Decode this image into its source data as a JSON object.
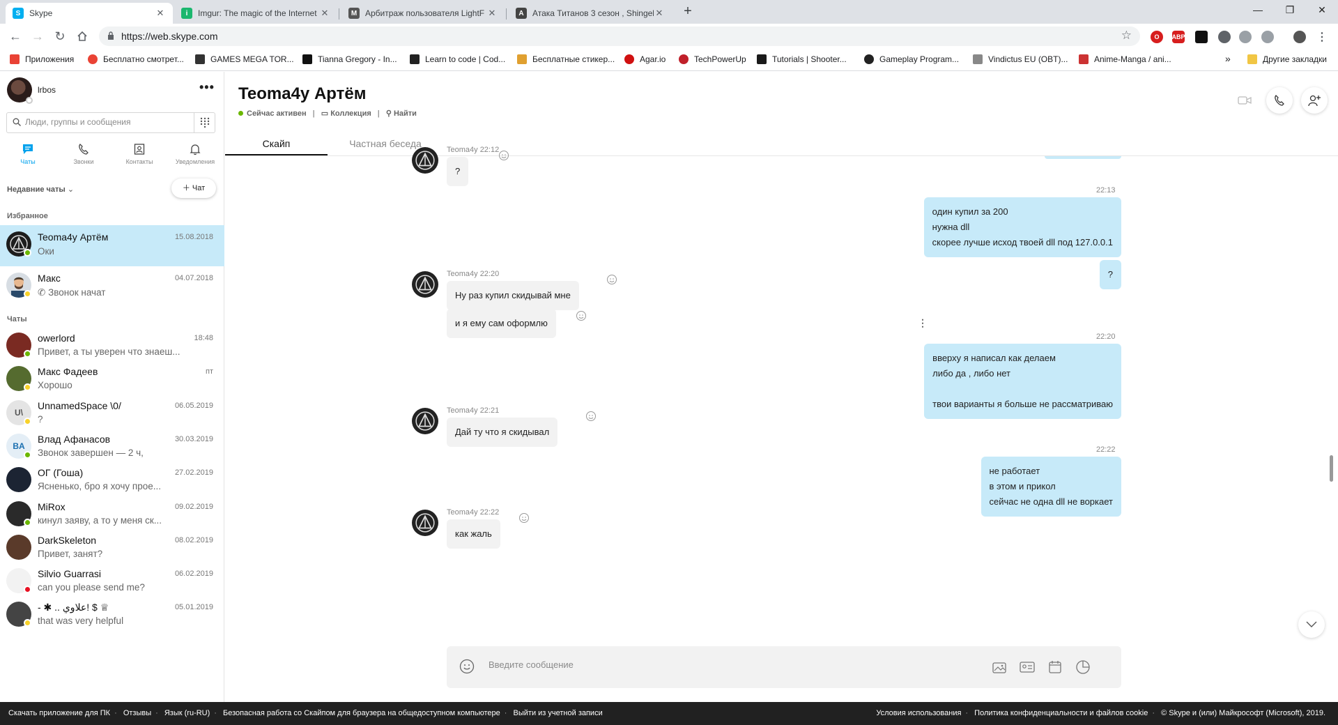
{
  "browser": {
    "tabs": [
      {
        "title": "Skype",
        "color": "#00aff0",
        "letter": "S"
      },
      {
        "title": "Imgur: The magic of the Internet",
        "color": "#1bb76e",
        "letter": "i"
      },
      {
        "title": "Арбитраж пользователя LightF",
        "color": "#555555",
        "letter": "M"
      },
      {
        "title": "Атака Титанов 3 сезон , Shingeki",
        "color": "#444444",
        "letter": "A"
      }
    ],
    "url": "https://web.skype.com",
    "bookmarks": [
      {
        "label": "Приложения",
        "color": "#e94235"
      },
      {
        "label": "Бесплатно смотрет...",
        "color": "#ea4335"
      },
      {
        "label": "GAMES MEGA TOR...",
        "color": "#333333"
      },
      {
        "label": "Tianna Gregory - In...",
        "color": "#111111"
      },
      {
        "label": "Learn to code | Cod...",
        "color": "#222222"
      },
      {
        "label": "Бесплатные стикер...",
        "color": "#e0a030"
      },
      {
        "label": "Agar.io",
        "color": "#d01010"
      },
      {
        "label": "TechPowerUp",
        "color": "#c0202a"
      },
      {
        "label": "Tutorials | Shooter...",
        "color": "#1a1a1a"
      },
      {
        "label": "Gameplay Program...",
        "color": "#222222"
      },
      {
        "label": "Vindictus EU (OBT)...",
        "color": "#888888"
      },
      {
        "label": "Anime-Manga / ani...",
        "color": "#cc3333"
      }
    ],
    "bookmarks_more": "»",
    "other_bookmarks": "Другие закладки"
  },
  "profile": {
    "name": "lrbos"
  },
  "search": {
    "placeholder": "Люди, группы и сообщения"
  },
  "nav": {
    "chats": "Чаты",
    "calls": "Звонки",
    "contacts": "Контакты",
    "notifications": "Уведомления"
  },
  "recent_label": "Недавние чаты",
  "new_chat_label": "Чат",
  "favorites_label": "Избранное",
  "chats_label": "Чаты",
  "favorites": [
    {
      "name": "Teoma4y Артём",
      "preview": "Оки",
      "date": "15.08.2018",
      "status": "#6bb700"
    },
    {
      "name": "Макс",
      "preview": "Звонок начат",
      "date": "04.07.2018",
      "status": "#f8d22a"
    }
  ],
  "chats": [
    {
      "name": "owerlord",
      "preview": "Привет, а ты уверен что знаеш...",
      "date": "18:48",
      "status": "#6bb700",
      "avatar_color": "#7a2a22",
      "initials": ""
    },
    {
      "name": "Макс Фадеев",
      "preview": "Хорошо",
      "date": "пт",
      "status": "#f8d22a",
      "avatar_color": "#556b2f",
      "initials": ""
    },
    {
      "name": "UnnamedSpace \\0/",
      "preview": "?",
      "date": "06.05.2019",
      "status": "#f8d22a",
      "avatar_color": "#e4e4e4",
      "initials": "U\\"
    },
    {
      "name": "Влад Афанасов",
      "preview": "Звонок завершен — 2 ч,",
      "date": "30.03.2019",
      "status": "#6bb700",
      "avatar_color": "#e4eef6",
      "initials": "BA"
    },
    {
      "name": "ОГ (Гоша)",
      "preview": "Ясненько, бро я хочу прое...",
      "date": "27.02.2019",
      "status": "",
      "avatar_color": "#1c2433",
      "initials": ""
    },
    {
      "name": "MiRox",
      "preview": "кинул заяву, а то у меня ск...",
      "date": "09.02.2019",
      "status": "#6bb700",
      "avatar_color": "#2a2a2a",
      "initials": ""
    },
    {
      "name": "DarkSkeleton",
      "preview": "Привет, занят?",
      "date": "08.02.2019",
      "status": "",
      "avatar_color": "#5a3a2a",
      "initials": ""
    },
    {
      "name": "Silvio Guarrasi",
      "preview": "can you please send me?",
      "date": "06.02.2019",
      "status": "#e81123",
      "avatar_color": "#f2f2f2",
      "initials": ""
    },
    {
      "name": "- ✱ .. علاوي! $ ♕",
      "preview": "that was very helpful",
      "date": "05.01.2019",
      "status": "#f8d22a",
      "avatar_color": "#444444",
      "initials": ""
    }
  ],
  "conversation": {
    "title": "Teoma4y Артём",
    "status": "Сейчас активен",
    "gallery": "Коллекция",
    "find": "Найти",
    "tab_skype": "Скайп",
    "tab_private": "Частная беседа",
    "messages": [
      {
        "dir": "in",
        "meta": "Teoma4y 22:12",
        "lines": [
          "?"
        ]
      },
      {
        "dir": "out",
        "time": "22:13",
        "bubbles": [
          "один купил за 200\nнужна dll\nскорее лучше исход твоей dll под 127.0.0.1",
          "?"
        ]
      },
      {
        "dir": "in",
        "meta": "Teoma4y 22:20",
        "lines": [
          "Ну раз купил скидывай мне",
          "и я ему сам оформлю"
        ]
      },
      {
        "dir": "out",
        "time": "22:20",
        "bubbles": [
          "вверху я написал как делаем\nлибо да , либо нет\n\nтвои варианты я больше не рассматриваю"
        ]
      },
      {
        "dir": "in",
        "meta": "Teoma4y 22:21",
        "lines": [
          "Дай ту что я скидывал"
        ]
      },
      {
        "dir": "out",
        "time": "22:22",
        "bubbles": [
          "не работает\nв этом и прикол\nсейчас не одна dll не воркает"
        ]
      },
      {
        "dir": "in",
        "meta": "Teoma4y 22:22",
        "lines": [
          "как жаль"
        ]
      }
    ],
    "composer_placeholder": "Введите сообщение"
  },
  "footer": {
    "left": [
      "Скачать приложение для ПК",
      "Отзывы",
      "Язык (ru-RU)",
      "Безопасная работа со Скайпом для браузера на общедоступном компьютере",
      "Выйти из учетной записи"
    ],
    "right": [
      "Условия использования",
      "Политика конфиденциальности и файлов cookie",
      "© Skype и (или) Майкрософт (Microsoft), 2019."
    ]
  },
  "colors": {
    "accent": "#00a2ed",
    "selected": "#c7eaf9",
    "online": "#6bb700",
    "away": "#f8d22a",
    "busy": "#e81123"
  }
}
